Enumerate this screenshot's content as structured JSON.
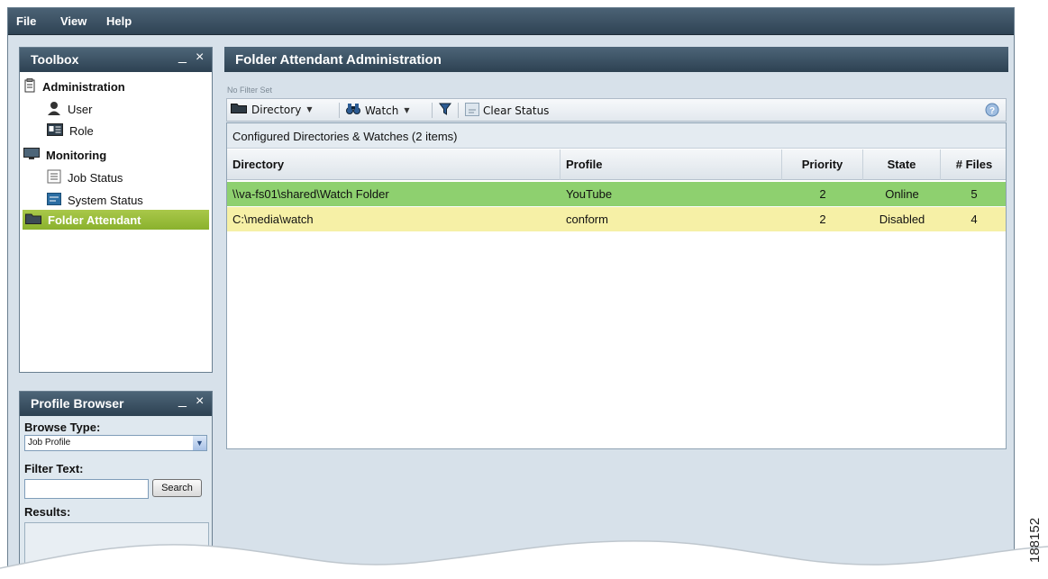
{
  "menubar": {
    "items": [
      "File",
      "View",
      "Help"
    ]
  },
  "toolbox": {
    "title": "Toolbox",
    "minimize": "_",
    "close": "×",
    "items": [
      {
        "label": "Administration",
        "icon": "clipboard-icon"
      },
      {
        "label": "User",
        "icon": "user-icon"
      },
      {
        "label": "Role",
        "icon": "id-card-icon"
      },
      {
        "label": "Monitoring",
        "icon": "monitor-icon"
      },
      {
        "label": "Job Status",
        "icon": "list-icon"
      },
      {
        "label": "System Status",
        "icon": "status-icon"
      },
      {
        "label": "Folder Attendant",
        "icon": "folder-icon"
      }
    ]
  },
  "profile_browser": {
    "title": "Profile Browser",
    "minimize": "_",
    "close": "×",
    "browse_type_label": "Browse Type:",
    "browse_type_value": "Job Profile",
    "filter_text_label": "Filter Text:",
    "filter_text_value": "",
    "search_label": "Search",
    "results_label": "Results:"
  },
  "main": {
    "title": "Folder Attendant Administration",
    "filter_status": "No Filter Set",
    "toolbar": {
      "directory": "Directory",
      "watch": "Watch",
      "clear_status": "Clear Status"
    },
    "grid": {
      "caption": "Configured Directories & Watches (2 items)",
      "columns": [
        "Directory",
        "Profile",
        "Priority",
        "State",
        "# Files"
      ],
      "rows": [
        {
          "directory": "\\\\va-fs01\\shared\\Watch Folder",
          "profile": "YouTube",
          "priority": "2",
          "state": "Online",
          "files": "5",
          "color": "#8ed06f"
        },
        {
          "directory": "C:\\media\\watch",
          "profile": "conform",
          "priority": "2",
          "state": "Disabled",
          "files": "4",
          "color": "#f6f0a6"
        }
      ]
    }
  },
  "figure_number": "188152",
  "colors": {
    "header": "#3a5063",
    "selected": "#9bbf3a",
    "online": "#8ed06f",
    "disabled": "#f6f0a6"
  }
}
